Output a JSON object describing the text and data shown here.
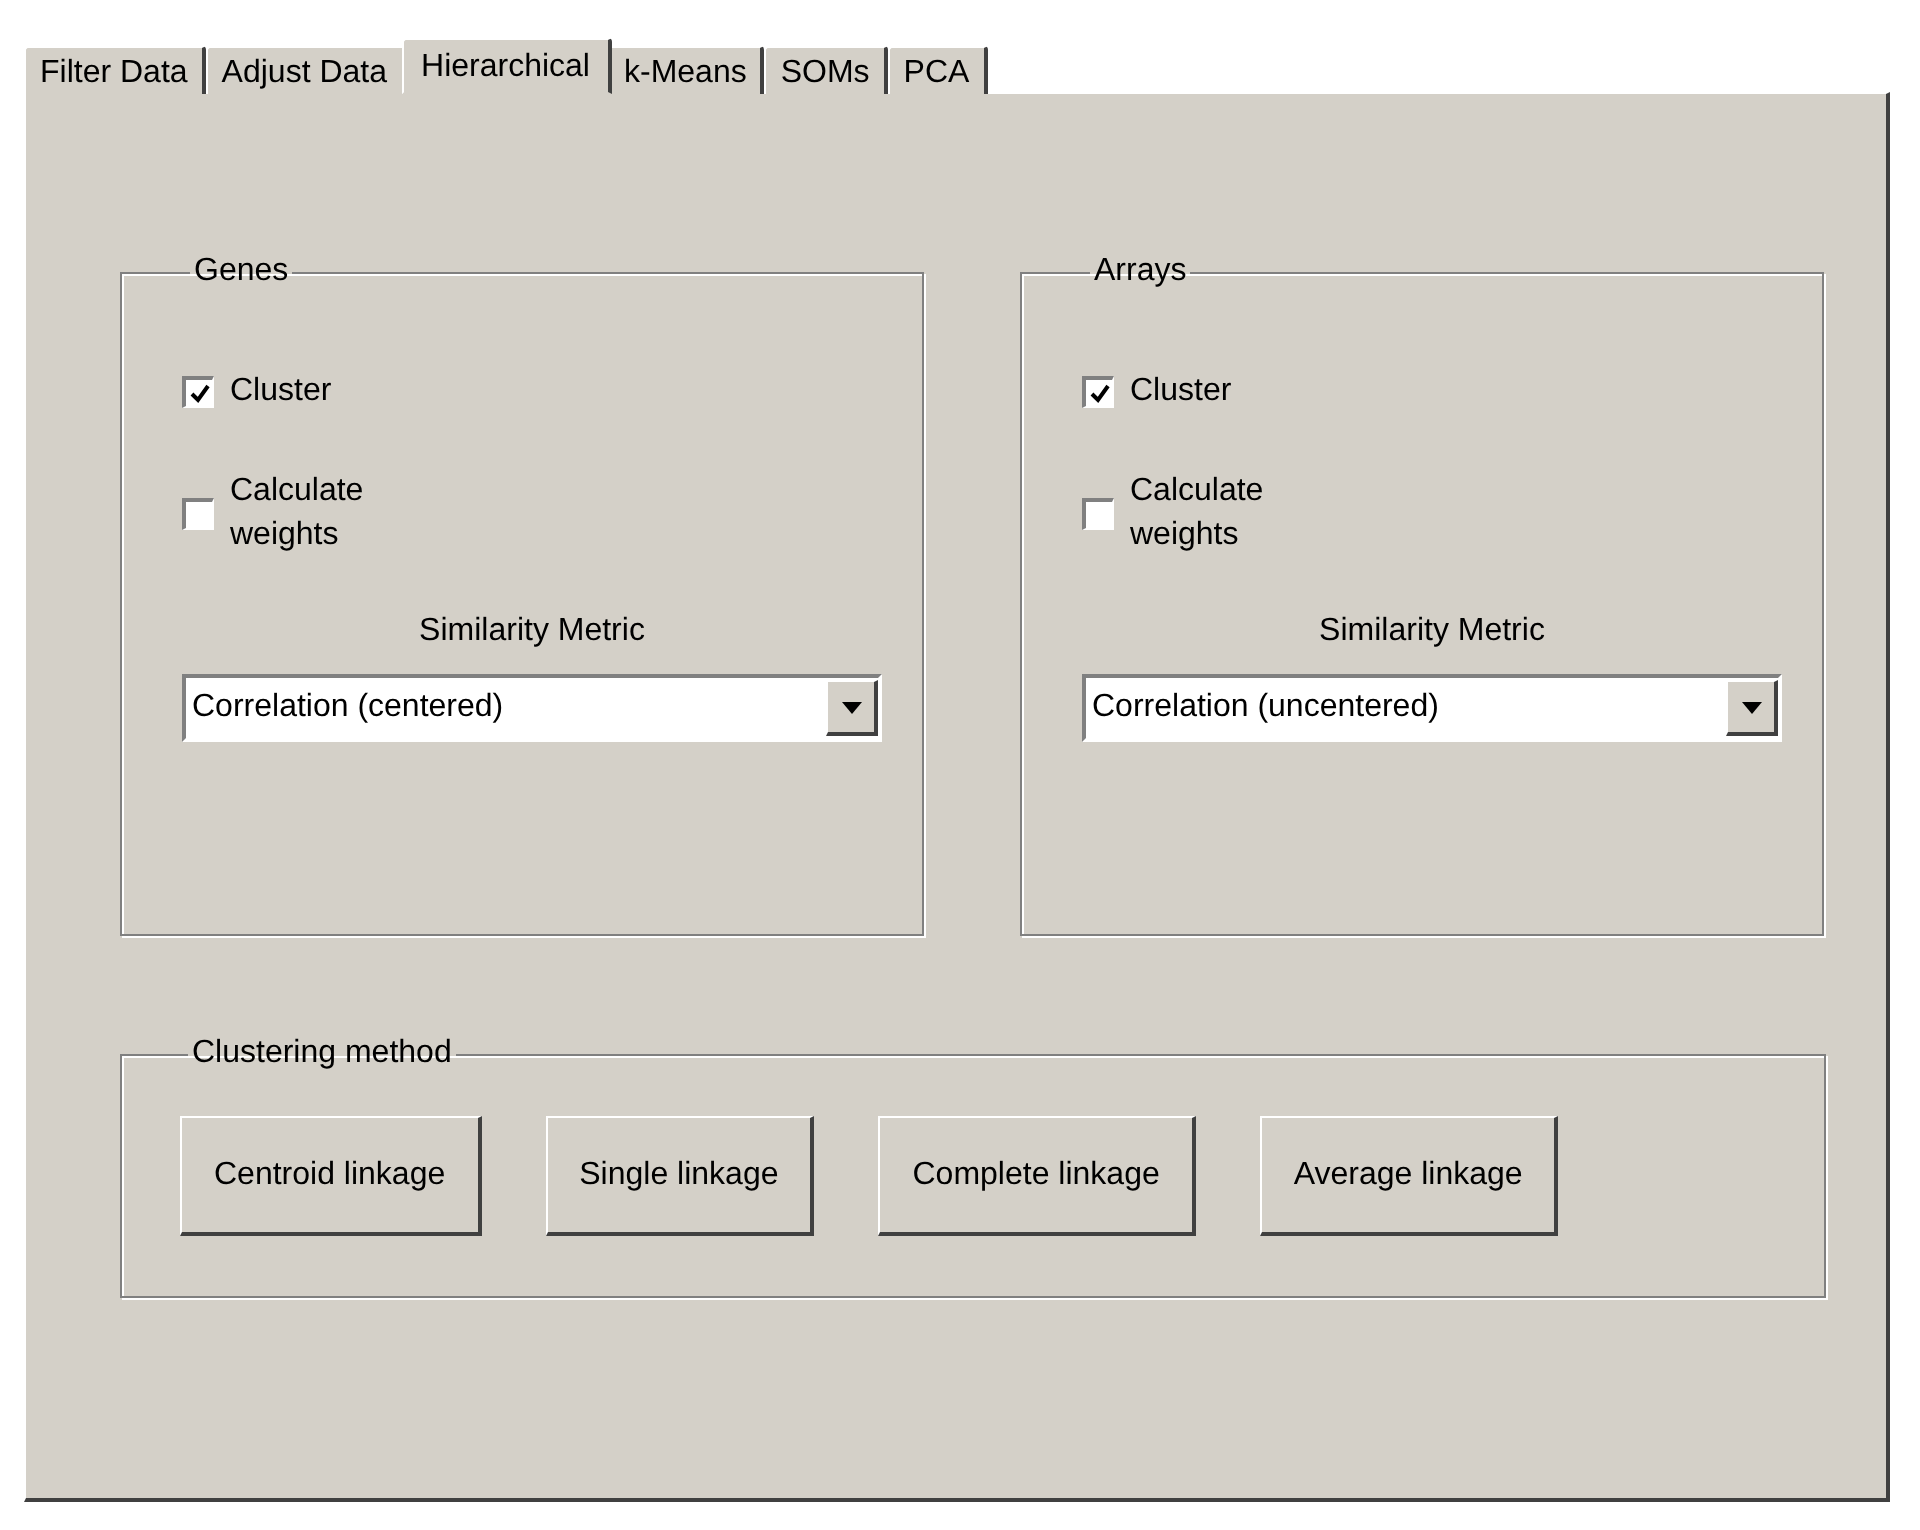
{
  "tabs": [
    {
      "label": "Filter Data",
      "selected": false
    },
    {
      "label": "Adjust Data",
      "selected": false
    },
    {
      "label": "Hierarchical",
      "selected": true
    },
    {
      "label": "k-Means",
      "selected": false
    },
    {
      "label": "SOMs",
      "selected": false
    },
    {
      "label": "PCA",
      "selected": false
    }
  ],
  "groups": [
    {
      "title": "Genes",
      "checkboxes": [
        {
          "label": "Cluster",
          "checked": true
        },
        {
          "label": "Calculate weights",
          "checked": false
        }
      ],
      "metric_label": "Similarity Metric",
      "metric": "Correlation (centered)"
    },
    {
      "title": "Arrays",
      "checkboxes": [
        {
          "label": "Cluster",
          "checked": true
        },
        {
          "label": "Calculate weights",
          "checked": false
        }
      ],
      "metric_label": "Similarity Metric",
      "metric": "Correlation (uncentered)"
    }
  ],
  "clustering_method": {
    "title": "Clustering method",
    "buttons": [
      "Centroid linkage",
      "Single linkage",
      "Complete linkage",
      "Average linkage"
    ]
  }
}
